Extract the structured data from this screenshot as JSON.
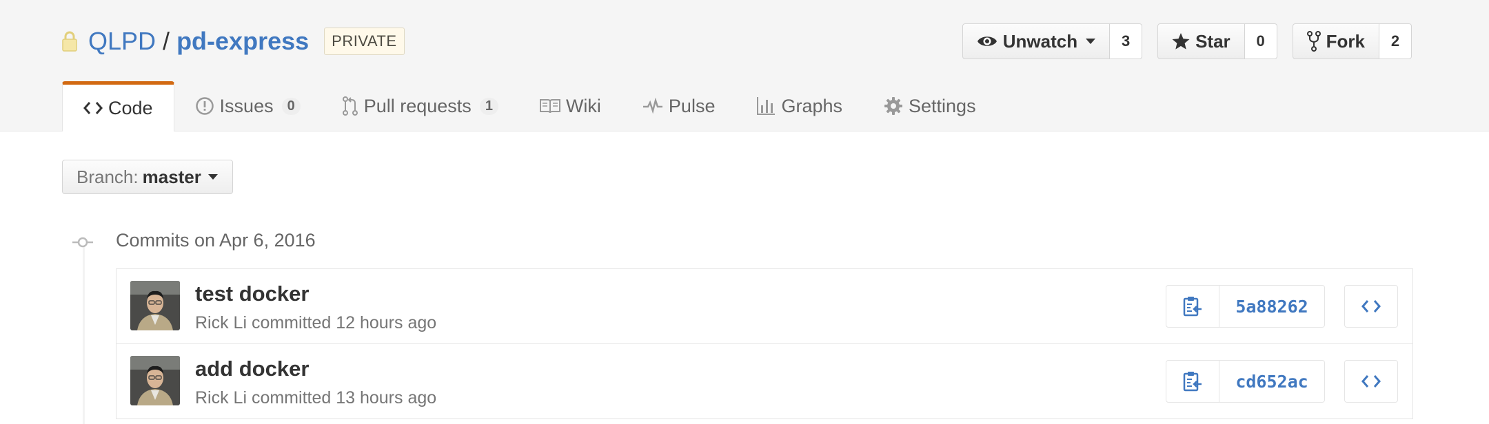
{
  "repo": {
    "owner": "QLPD",
    "separator": "/",
    "name": "pd-express",
    "visibility": "PRIVATE"
  },
  "actions": {
    "watch": {
      "label": "Unwatch",
      "count": "3"
    },
    "star": {
      "label": "Star",
      "count": "0"
    },
    "fork": {
      "label": "Fork",
      "count": "2"
    }
  },
  "tabs": [
    {
      "label": "Code",
      "icon": "code-icon",
      "selected": true
    },
    {
      "label": "Issues",
      "icon": "issue-icon",
      "counter": "0"
    },
    {
      "label": "Pull requests",
      "icon": "pull-request-icon",
      "counter": "1"
    },
    {
      "label": "Wiki",
      "icon": "book-icon"
    },
    {
      "label": "Pulse",
      "icon": "pulse-icon"
    },
    {
      "label": "Graphs",
      "icon": "graph-icon"
    },
    {
      "label": "Settings",
      "icon": "gear-icon"
    }
  ],
  "branch": {
    "label": "Branch:",
    "value": "master"
  },
  "commit_group": {
    "title": "Commits on Apr 6, 2016"
  },
  "commits": [
    {
      "message": "test docker",
      "author": "Rick Li",
      "meta": "Rick Li committed 12 hours ago",
      "sha": "5a88262"
    },
    {
      "message": "add docker",
      "author": "Rick Li",
      "meta": "Rick Li committed 13 hours ago",
      "sha": "cd652ac"
    }
  ],
  "colors": {
    "link": "#4078c0",
    "tab_accent": "#d26911",
    "header_bg": "#f5f5f5"
  }
}
